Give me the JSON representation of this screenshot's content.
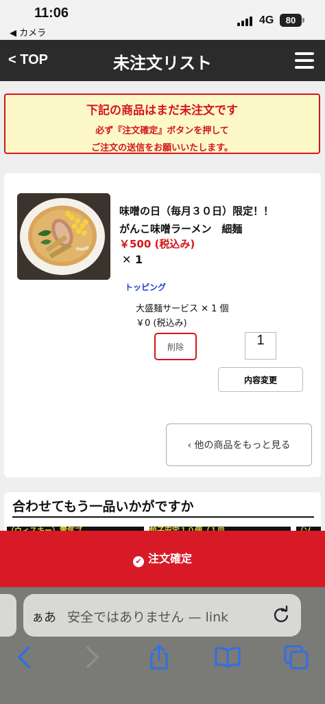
{
  "status_bar": {
    "time": "11:06",
    "back_app": "◀ カメラ",
    "network": "4G",
    "battery": "80"
  },
  "header": {
    "top_link": "< TOP",
    "title": "未注文リスト"
  },
  "notice": {
    "line1": "下記の商品はまだ未注文です",
    "line2": "必ず『注文確定』ボタンを押して",
    "line3": "ご注文の送信をお願いいたします。"
  },
  "cart_item": {
    "name_line1": "味噌の日（毎月３０日）限定！！",
    "name_line2": "がんこ味噌ラーメン　細麺",
    "price": "￥500 (税込み)",
    "quantity": "✕ 1",
    "topping_label": "トッピング",
    "topping_line": "大盛麺サービス ✕ 1 個",
    "topping_price": "￥0 (税込み)",
    "delete_label": "削除",
    "qty_value": "1",
    "change_label": "内容変更",
    "more_label": "‹ 他の商品をもっと見る"
  },
  "recommend": {
    "title": "合わせてもう一品いかがですか",
    "strip1": "（ウィスキー）電気ブ",
    "strip2": "餃子安定１０個（１皿",
    "strip3": "（ソ"
  },
  "confirm": {
    "label": "注文確定"
  },
  "safari": {
    "aa": "ぁあ",
    "url": "安全ではありません — link"
  },
  "colors": {
    "accent_red": "#d81a27",
    "header_bg": "#2b2b2b",
    "notice_bg": "#fdf8c8",
    "topping_blue": "#1f3ed0",
    "safari_blue": "#2f6fe8"
  }
}
